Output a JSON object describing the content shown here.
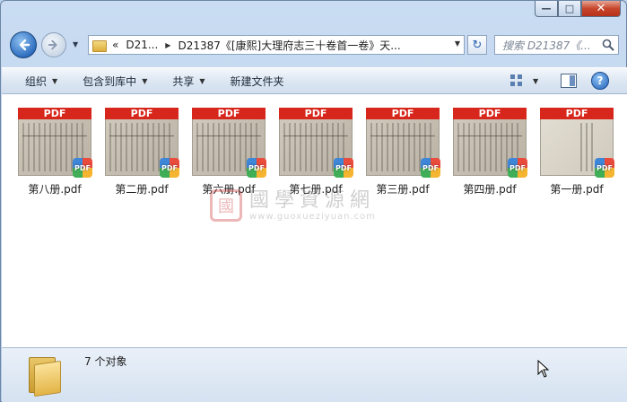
{
  "address": {
    "overflow": "«",
    "segments": [
      "D21...",
      "D21387《[康熙]大理府志三十卷首一卷》天..."
    ]
  },
  "search": {
    "placeholder": "搜索 D21387《..."
  },
  "toolbar": {
    "organize": "组织",
    "include_in_library": "包含到库中",
    "share": "共享",
    "new_folder": "新建文件夹"
  },
  "files": [
    {
      "name": "第八册.pdf",
      "badge": "PDF",
      "header": "PDF"
    },
    {
      "name": "第二册.pdf",
      "badge": "PDF",
      "header": "PDF"
    },
    {
      "name": "第六册.pdf",
      "badge": "PDF",
      "header": "PDF"
    },
    {
      "name": "第七册.pdf",
      "badge": "PDF",
      "header": "PDF"
    },
    {
      "name": "第三册.pdf",
      "badge": "PDF",
      "header": "PDF"
    },
    {
      "name": "第四册.pdf",
      "badge": "PDF",
      "header": "PDF"
    },
    {
      "name": "第一册.pdf",
      "badge": "PDF",
      "header": "PDF"
    }
  ],
  "watermark": {
    "seal": "國",
    "chinese": "國學資源網",
    "url": "www.guoxueziyuan.com"
  },
  "status": {
    "count_text": "7 个对象"
  },
  "colors": {
    "pdf_header": "#d7261b",
    "accent": "#2f6fc0"
  }
}
